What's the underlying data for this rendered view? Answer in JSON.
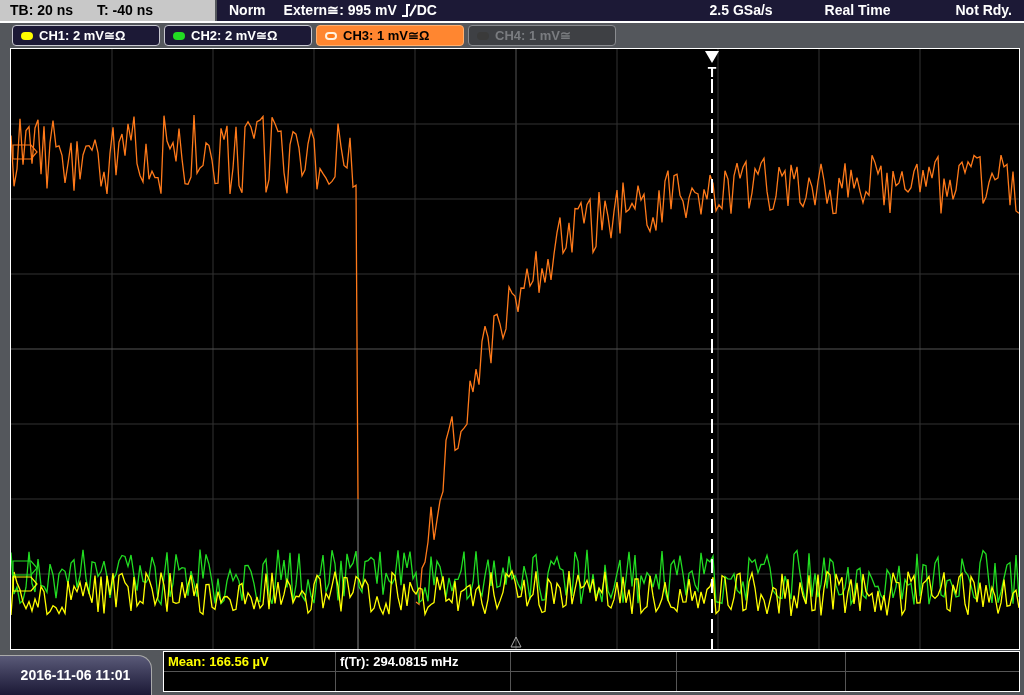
{
  "top_bar": {
    "timebase": "TB: 20 ns",
    "trigger_time": "T: -40 ns",
    "mode": "Norm",
    "trigger_source": "Extern≅: 995 mV",
    "trigger_coupling": "DC",
    "sample_rate": "2.5 GSa/s",
    "acquisition": "Real Time",
    "status": "Not Rdy."
  },
  "channels": [
    {
      "label": "CH1: 2 mV≅Ω",
      "color": "#ffff00",
      "selected": false,
      "disabled": false
    },
    {
      "label": "CH2: 2 mV≅Ω",
      "color": "#22dd22",
      "selected": false,
      "disabled": false
    },
    {
      "label": "CH3: 1 mV≅Ω",
      "color": "#ff7a1a",
      "selected": true,
      "disabled": false
    },
    {
      "label": "CH4: 1 mV≅",
      "color": "#3a3a3a",
      "selected": false,
      "disabled": true
    }
  ],
  "trigger_marker": {
    "label": "T"
  },
  "date": "2016-11-06 11:01",
  "measurements": [
    {
      "label": "Mean: 166.56 µV",
      "color": "#ffff00"
    },
    {
      "label": "f(Tr): 294.0815 mHz",
      "color": "#ffffff"
    }
  ]
}
